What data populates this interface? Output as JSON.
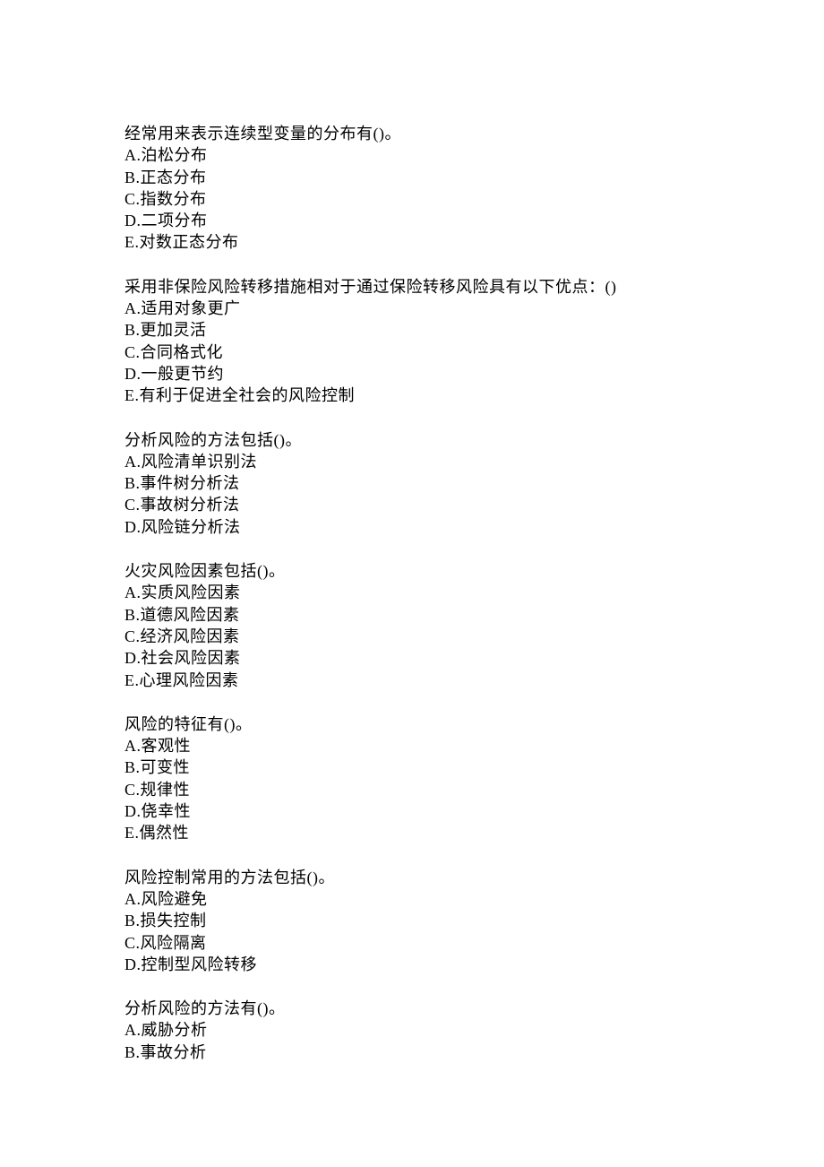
{
  "questions": [
    {
      "stem": "经常用来表示连续型变量的分布有()。",
      "options": [
        "A.泊松分布",
        "B.正态分布",
        "C.指数分布",
        "D.二项分布",
        "E.对数正态分布"
      ]
    },
    {
      "stem": "采用非保险风险转移措施相对于通过保险转移风险具有以下优点：()",
      "options": [
        "A.适用对象更广",
        "B.更加灵活",
        "C.合同格式化",
        "D.一般更节约",
        "E.有利于促进全社会的风险控制"
      ]
    },
    {
      "stem": "分析风险的方法包括()。",
      "options": [
        "A.风险清单识别法",
        "B.事件树分析法",
        "C.事故树分析法",
        "D.风险链分析法"
      ]
    },
    {
      "stem": "火灾风险因素包括()。",
      "options": [
        "A.实质风险因素",
        "B.道德风险因素",
        "C.经济风险因素",
        "D.社会风险因素",
        "E.心理风险因素"
      ]
    },
    {
      "stem": "风险的特征有()。",
      "options": [
        "A.客观性",
        "B.可变性",
        "C.规律性",
        "D.侥幸性",
        "E.偶然性"
      ]
    },
    {
      "stem": "风险控制常用的方法包括()。",
      "options": [
        "A.风险避免",
        "B.损失控制",
        "C.风险隔离",
        "D.控制型风险转移"
      ]
    },
    {
      "stem": "分析风险的方法有()。",
      "options": [
        "A.威胁分析",
        "B.事故分析"
      ]
    }
  ]
}
